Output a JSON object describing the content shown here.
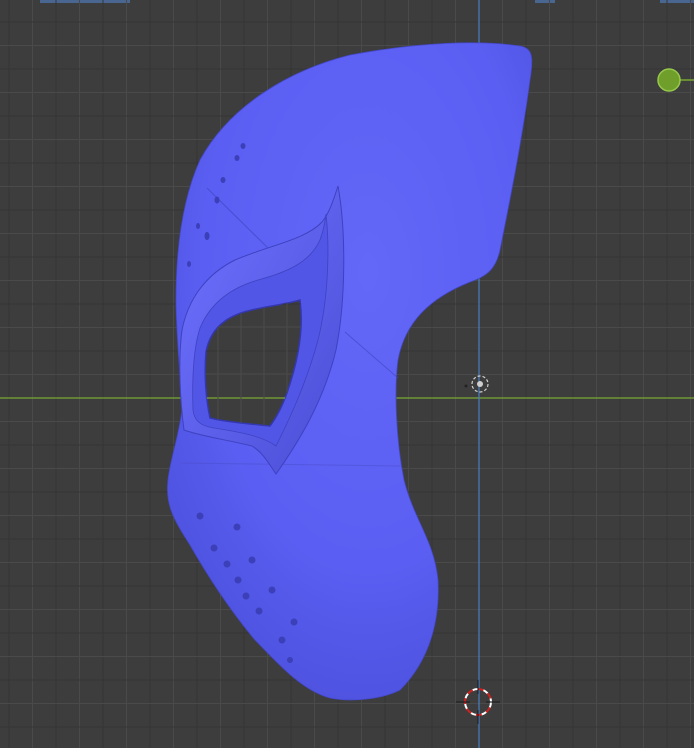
{
  "viewport": {
    "background_color": "#3d3d3d",
    "grid_minor_color": "#4a4a4a",
    "grid_major_color": "#353535",
    "x_axis_color": "#7aa832",
    "y_axis_color": "#4a7fc0",
    "mesh_color": "#5b5ff0",
    "mesh_shade_color": "#4a4ed8",
    "mesh_highlight_color": "#6f73ff"
  },
  "scene": {
    "object": "mask-mesh",
    "origin_marker": "origin-icon",
    "cursor_marker": "3d-cursor-icon",
    "gizmo": "light-gizmo-icon"
  }
}
